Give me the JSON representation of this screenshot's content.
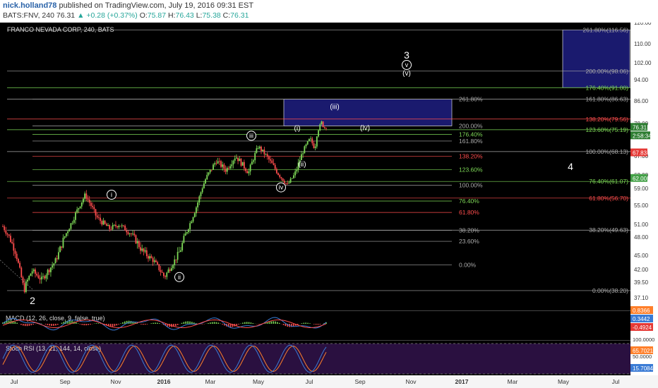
{
  "header": {
    "user": "nick.holland78",
    "published": "published on TradingView.com, July 19, 2016 09:31 EST",
    "symbol": "BATS:FNV, 240",
    "last": "76.31",
    "change": "▲ +0.28 (+0.37%)",
    "o_label": "O:",
    "o": "75.87",
    "h_label": "H:",
    "h": "76.43",
    "l_label": "L:",
    "l": "75.38",
    "c_label": "C:",
    "c": "76.31"
  },
  "colors": {
    "background": "#000000",
    "fib_green": "#7ed957",
    "fib_red": "#ff4d4d",
    "fib_gray": "#aaaaaa",
    "box_blue": "#1a1a6e",
    "macd_line": "#3a7bd5",
    "signal_line": "#ff4d4d",
    "stoch_k": "#3a7bd5",
    "stoch_d": "#ff7f2a",
    "stoch_band": "#2a1040"
  },
  "chart_data": [
    {
      "type": "candlestick",
      "title": "FRANCO NEVADA CORP, 240, BATS",
      "x_ticks": [
        "Jul",
        "Sep",
        "Nov",
        "2016",
        "Mar",
        "May",
        "Jul",
        "Sep",
        "Nov",
        "2017",
        "Mar",
        "May",
        "Jul"
      ],
      "y_ticks": [
        "120.00",
        "110.00",
        "102.00",
        "94.00",
        "86.00",
        "78.00",
        "72.00",
        "67.00",
        "63.00",
        "59.00",
        "55.00",
        "51.00",
        "48.00",
        "45.00",
        "42.00",
        "39.50",
        "37.10"
      ],
      "ylim": [
        36.5,
        121
      ],
      "price_path": [
        [
          0.0,
          50.5
        ],
        [
          0.04,
          45.5
        ],
        [
          0.065,
          38.2
        ],
        [
          0.09,
          41.8
        ],
        [
          0.12,
          40.0
        ],
        [
          0.16,
          43.5
        ],
        [
          0.22,
          52.5
        ],
        [
          0.255,
          57.5
        ],
        [
          0.29,
          52.5
        ],
        [
          0.33,
          50.0
        ],
        [
          0.36,
          51.0
        ],
        [
          0.4,
          48.5
        ],
        [
          0.43,
          45.8
        ],
        [
          0.465,
          44.0
        ],
        [
          0.5,
          40.5
        ],
        [
          0.55,
          46.0
        ],
        [
          0.6,
          55.0
        ],
        [
          0.63,
          62.5
        ],
        [
          0.66,
          66.0
        ],
        [
          0.69,
          64.0
        ],
        [
          0.72,
          67.0
        ],
        [
          0.76,
          63.5
        ],
        [
          0.79,
          69.5
        ],
        [
          0.82,
          66.5
        ],
        [
          0.85,
          63.5
        ],
        [
          0.88,
          60.0
        ],
        [
          0.905,
          63.5
        ],
        [
          0.93,
          68.5
        ],
        [
          0.95,
          71.5
        ],
        [
          0.965,
          69.0
        ],
        [
          0.975,
          75.0
        ],
        [
          0.985,
          78.6
        ],
        [
          0.993,
          76.0
        ],
        [
          1.0,
          76.31
        ]
      ],
      "last_price": "76.31",
      "last_time": "2:58:34",
      "price_labels": [
        {
          "text": "67.83",
          "value": 67.83,
          "color": "#e53935"
        },
        {
          "text": "62.00",
          "value": 62.0,
          "color": "#43a047"
        }
      ],
      "fib_left": [
        {
          "label": "261.80%",
          "value": 86.63,
          "color": "#aaaaaa"
        },
        {
          "label": "200.00%",
          "value": 76.9,
          "color": "#aaaaaa"
        },
        {
          "label": "176.40%",
          "value": 73.1,
          "color": "#7ed957"
        },
        {
          "label": "161.80%",
          "value": 70.9,
          "color": "#aaaaaa"
        },
        {
          "label": "138.20%",
          "value": 66.9,
          "color": "#ff4d4d"
        },
        {
          "label": "123.60%",
          "value": 64.1,
          "color": "#7ed957"
        },
        {
          "label": "100.00%",
          "value": 59.9,
          "color": "#aaaaaa"
        },
        {
          "label": "76.40%",
          "value": 56.0,
          "color": "#7ed957"
        },
        {
          "label": "61.80%",
          "value": 53.5,
          "color": "#ff4d4d"
        },
        {
          "label": "38.20%",
          "value": 49.6,
          "color": "#aaaaaa"
        },
        {
          "label": "23.60%",
          "value": 47.3,
          "color": "#aaaaaa"
        },
        {
          "label": "0.00%",
          "value": 43.0,
          "color": "#aaaaaa"
        }
      ],
      "fib_right": [
        {
          "label": "261.80%(116.56)",
          "value": 116.56,
          "color": "#aaaaaa"
        },
        {
          "label": "200.00%(98.06)",
          "value": 98.06,
          "color": "#aaaaaa"
        },
        {
          "label": "176.40%(91.00)",
          "value": 91.0,
          "color": "#7ed957"
        },
        {
          "label": "161.80%(86.63)",
          "value": 86.63,
          "color": "#aaaaaa"
        },
        {
          "label": "138.20%(79.56)",
          "value": 79.56,
          "color": "#ff4d4d"
        },
        {
          "label": "123.60%(75.19)",
          "value": 75.19,
          "color": "#7ed957"
        },
        {
          "label": "100.00%(68.13)",
          "value": 68.13,
          "color": "#aaaaaa"
        },
        {
          "label": "76.40%(61.07)",
          "value": 61.07,
          "color": "#7ed957"
        },
        {
          "label": "61.80%(56.70)",
          "value": 56.7,
          "color": "#ff4d4d"
        },
        {
          "label": "38.20%(49.63)",
          "value": 49.63,
          "color": "#aaaaaa"
        },
        {
          "label": "0.00%(38.20)",
          "value": 38.2,
          "color": "#aaaaaa"
        }
      ],
      "wave_labels": [
        {
          "text": "2",
          "value": 36.5,
          "style": "plain"
        },
        {
          "text": "i",
          "value": 57.5,
          "style": "circled"
        },
        {
          "text": "ii",
          "value": 40.5,
          "style": "circled"
        },
        {
          "text": "iii",
          "value": 72.5,
          "style": "circled"
        },
        {
          "text": "iv",
          "value": 59.3,
          "style": "circled"
        },
        {
          "text": "(i)",
          "value": 76.1,
          "style": "plain"
        },
        {
          "text": "(ii)",
          "value": 65.4,
          "style": "plain"
        },
        {
          "text": "(iii)",
          "value": 84.1,
          "style": "plain"
        },
        {
          "text": "(iv)",
          "value": 76.3,
          "style": "plain"
        },
        {
          "text": "3",
          "value": 105.0,
          "style": "plain"
        },
        {
          "text": "v",
          "value": 101.0,
          "style": "circled"
        },
        {
          "text": "(v)",
          "value": 97.4,
          "style": "plain"
        },
        {
          "text": "4",
          "value": 64.6,
          "style": "plain"
        }
      ]
    },
    {
      "type": "line",
      "title": "MACD (12, 26, close, 9, false, true)",
      "values_shown": [
        "0.8366",
        "0.3442",
        "-0.4924"
      ]
    },
    {
      "type": "line",
      "title": "Stoch RSI (13, 21, 144, 14, close)",
      "y_ticks": [
        "100.0000",
        "50.0000",
        "0.0000"
      ],
      "values_shown": [
        "65.7021",
        "15.7084"
      ]
    }
  ]
}
